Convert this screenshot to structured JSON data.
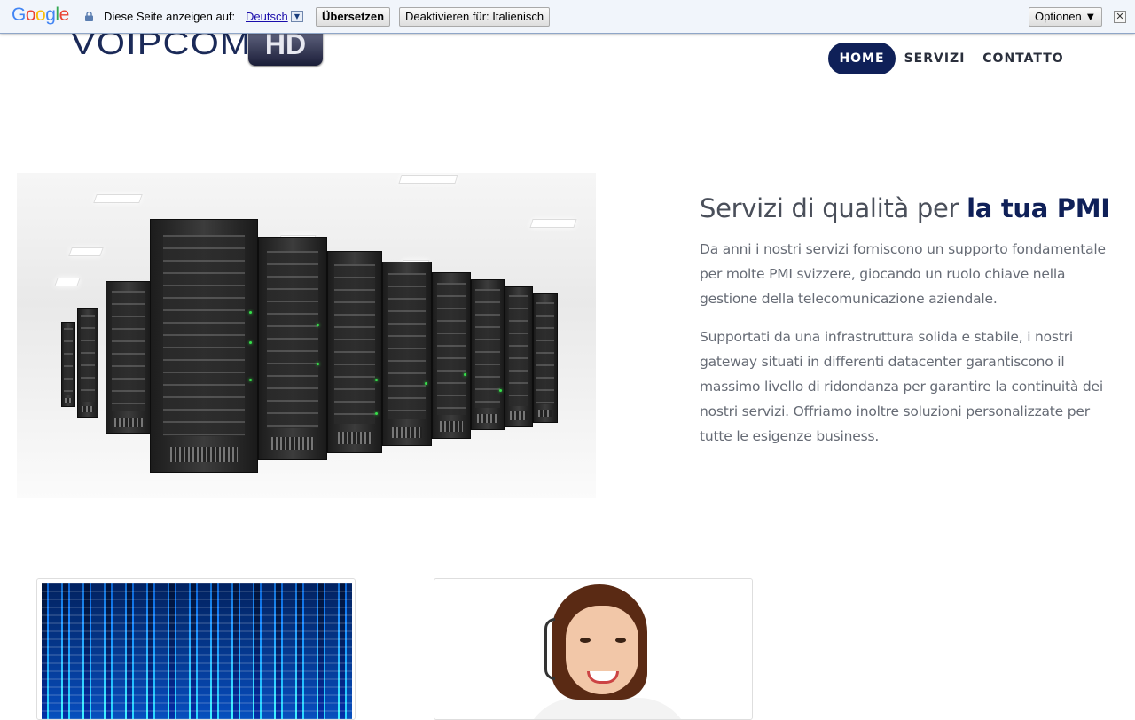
{
  "translate_bar": {
    "logo": "Google",
    "prompt": "Diese Seite anzeigen auf:",
    "language": "Deutsch",
    "translate_button": "Übersetzen",
    "disable_button": "Deaktivieren für: Italienisch",
    "options_button": "Optionen ▼",
    "close": "✕"
  },
  "header": {
    "logo_text": "VOIPCOM",
    "logo_badge": "HD"
  },
  "nav": {
    "items": [
      {
        "label": "HOME",
        "active": true
      },
      {
        "label": "SERVIZI",
        "active": false
      },
      {
        "label": "CONTATTO",
        "active": false
      }
    ]
  },
  "main": {
    "headline_plain": "Servizi di qualità per ",
    "headline_bold": "la tua PMI",
    "paragraph1": "Da anni i nostri servizi forniscono un supporto fondamentale per molte PMI svizzere, giocando un ruolo chiave nella gestione della telecomunicazione aziendale.",
    "paragraph2": "Supportati da una infrastruttura solida e stabile, i nostri gateway situati in differenti datacenter garantiscono il massimo livello di ridondanza per garantire la continuità dei nostri servizi. Offriamo inoltre soluzioni personalizzate per tutte le esigenze business."
  },
  "colors": {
    "brand_navy": "#0f2058",
    "text_gray": "#666b75"
  }
}
